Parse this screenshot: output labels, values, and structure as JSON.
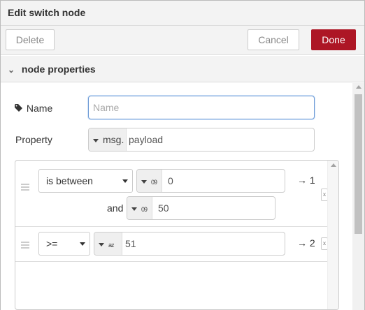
{
  "dialog": {
    "title": "Edit switch node",
    "delete_label": "Delete",
    "cancel_label": "Cancel",
    "done_label": "Done",
    "done_color": "#ad1625"
  },
  "section": {
    "title": "node properties"
  },
  "form": {
    "name_label": "Name",
    "name_placeholder": "Name",
    "name_value": "",
    "property_label": "Property",
    "property_type": "msg.",
    "property_value": "payload"
  },
  "rules": [
    {
      "operator": "is between",
      "type_icon": "09",
      "value": "0",
      "and_label": "and",
      "value2_type_icon": "09",
      "value2": "50",
      "output": "→ 1"
    },
    {
      "operator": ">=",
      "type_icon": "az",
      "value": "51",
      "output": "→ 2"
    }
  ]
}
